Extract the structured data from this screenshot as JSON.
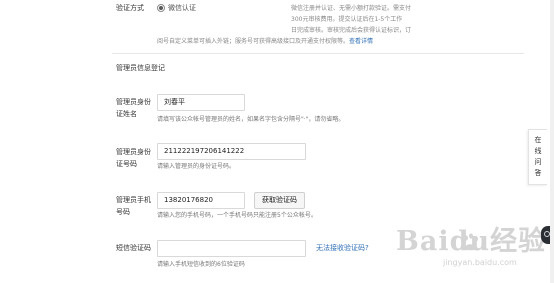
{
  "verify": {
    "label": "验证方式",
    "option": "微信认证",
    "desc_lines": [
      "微信注册并认证、无需小额打款验证。需支付",
      "300元审核费用。提交认证后在1-5个工作",
      "日完成审核。审核完成后会获得认证标识，订"
    ],
    "desc_last": "阅号自定义菜单可插入外链；服务号可获得高级接口及开通支付权限等。",
    "desc_link": "查看详情"
  },
  "section": {
    "title": "管理员信息登记"
  },
  "admin_name": {
    "label_lines": [
      "管理员身份",
      "证姓名"
    ],
    "value": "刘春平",
    "hint": "请填写该公众帐号管理员的姓名，如果名字包含分隔号\"·\"，请勿省略。"
  },
  "admin_id": {
    "label_lines": [
      "管理员身份",
      "证号码"
    ],
    "value": "211222197206141222",
    "hint": "请输入管理员的身份证号码。"
  },
  "admin_phone": {
    "label_lines": [
      "管理员手机",
      "号码"
    ],
    "value": "13820176820",
    "button": "获取验证码",
    "hint": "请输入您的手机号码，一个手机号码只能注册5个公众帐号。"
  },
  "sms": {
    "label": "短信验证码",
    "value": "",
    "link": "无法接收验证码?",
    "hint": "请输入手机短信收到的6位验证码"
  },
  "side_widget": {
    "chars": [
      "在",
      "线",
      "问",
      "答"
    ]
  },
  "watermark": {
    "text": "Baidu经验",
    "sub": "jingyan.baidu.com"
  }
}
